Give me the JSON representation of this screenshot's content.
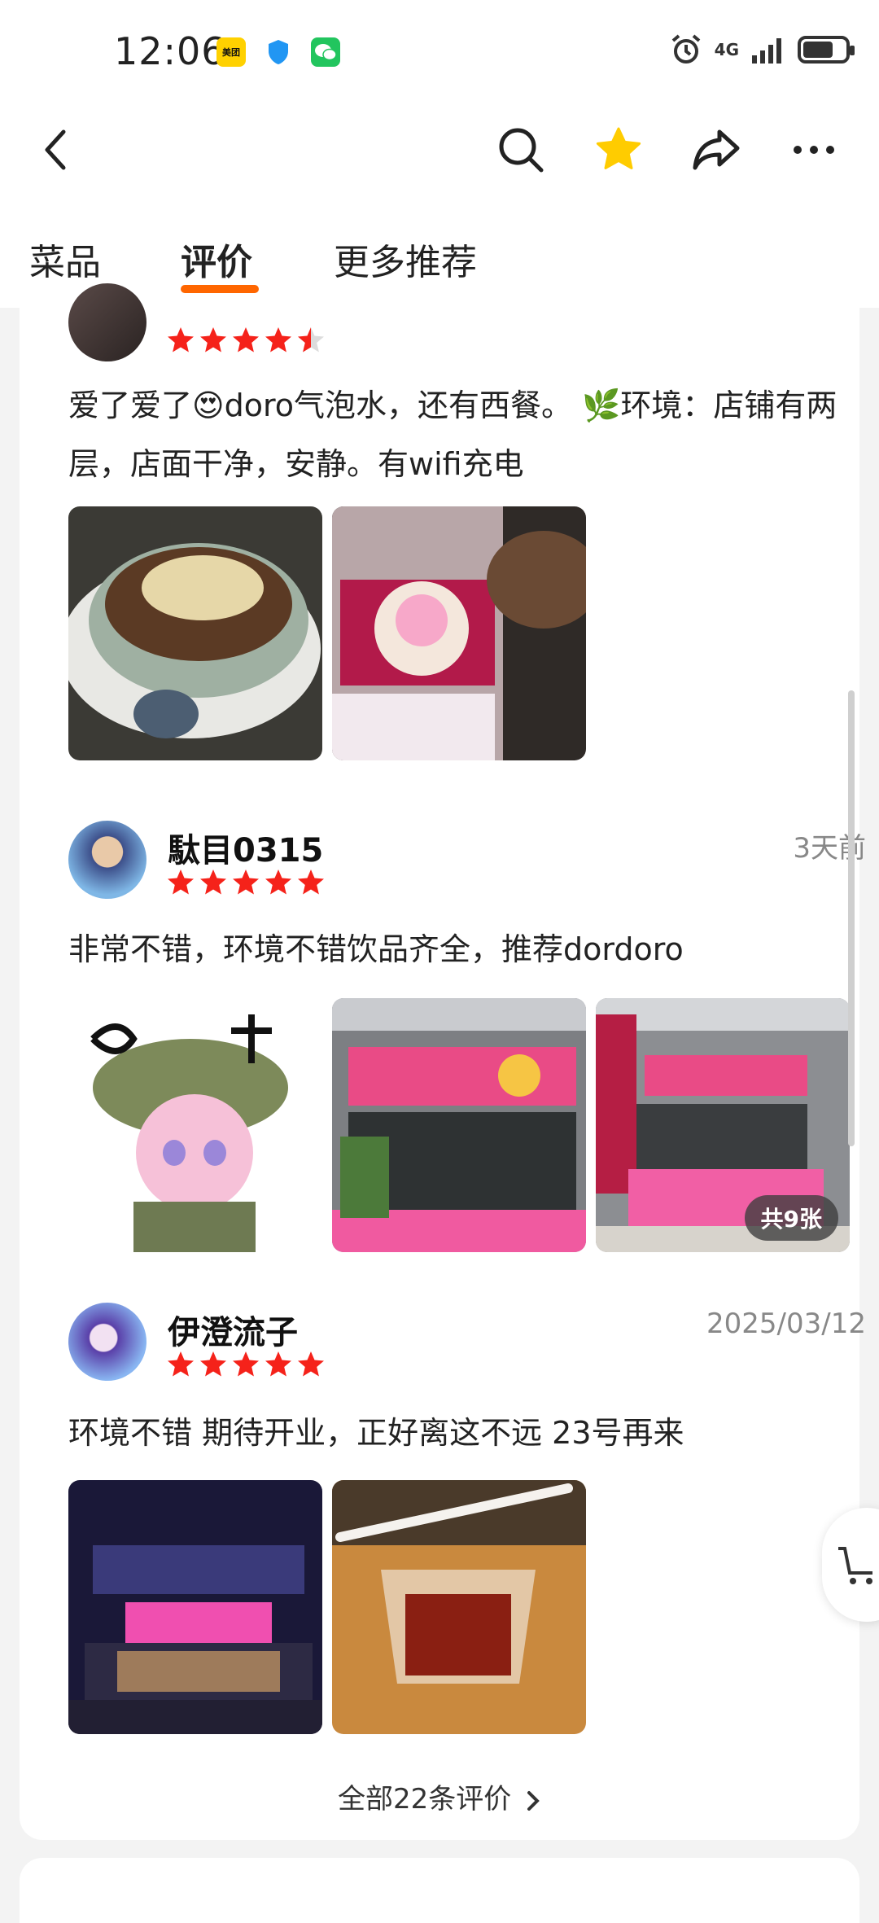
{
  "status_bar": {
    "time": "12:06",
    "meituan_badge": "美团",
    "network": "4G",
    "battery_level": 0.65
  },
  "tabs": [
    {
      "label": "菜品",
      "active": false
    },
    {
      "label": "评价",
      "active": true
    },
    {
      "label": "更多推荐",
      "active": false
    }
  ],
  "reviews": [
    {
      "user": "",
      "date": "",
      "rating": 4.5,
      "text": "爱了爱了😍doro气泡水，还有西餐。 🌿环境：店铺有两层，店面干净，安静。有wifi充电",
      "photos": [
        "baked-rice-photo",
        "doro-cup-photo"
      ],
      "photo_count": ""
    },
    {
      "user": "駄目0315",
      "date": "3天前",
      "rating": 5,
      "text": "非常不错，环境不错饮品齐全，推荐dordoro",
      "photos": [
        "sticker-photo",
        "storefront-photo",
        "storefront-side-photo"
      ],
      "photo_count": "共9张"
    },
    {
      "user": "伊澄流子",
      "date": "2025/03/12",
      "rating": 5,
      "text": "环境不错 期待开业，正好离这不远 23号再来",
      "photos": [
        "night-storefront-photo",
        "iced-tea-photo"
      ],
      "photo_count": ""
    }
  ],
  "all_reviews_link": "全部22条评价",
  "colors": {
    "accent": "#ff6600",
    "star": "#f5221a",
    "favorite_star": "#ffcc00"
  }
}
